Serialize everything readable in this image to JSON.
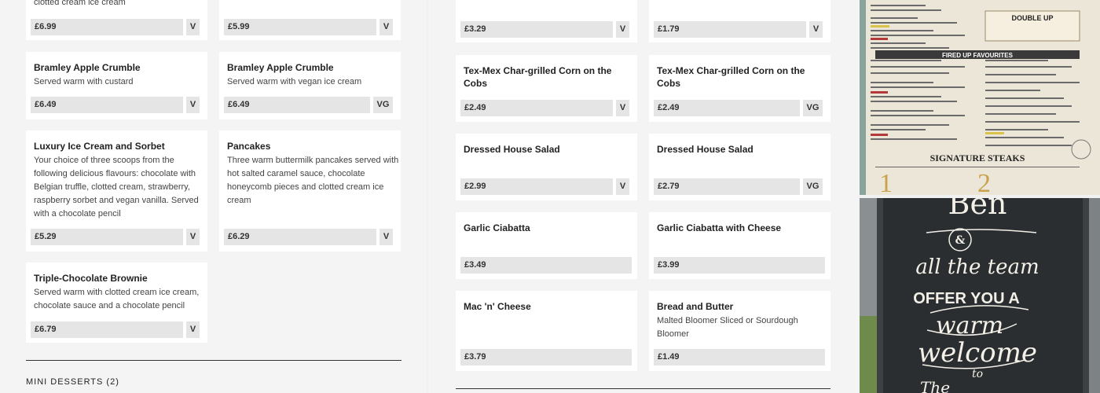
{
  "left_column": {
    "cards": [
      {
        "desc": "clotted cream ice cream",
        "price": "£6.99",
        "badge": "V"
      },
      {
        "desc": "",
        "price": "£5.99",
        "badge": "V"
      },
      {
        "title": "Bramley Apple Crumble",
        "desc": "Served warm with custard",
        "price": "£6.49",
        "badge": "V"
      },
      {
        "title": "Bramley Apple Crumble",
        "desc": "Served warm with vegan ice cream",
        "price": "£6.49",
        "badge": "VG"
      },
      {
        "title": "Luxury Ice Cream and Sorbet",
        "desc_lines": [
          "Your choice of three scoops from the",
          "following delicious flavours: chocolate with",
          "Belgian truffle, clotted cream, strawberry,",
          "raspberry sorbet and vegan vanilla. Served",
          "with a chocolate pencil"
        ],
        "price": "£5.29",
        "badge": "V"
      },
      {
        "title": "Pancakes",
        "desc_lines": [
          "Three warm buttermilk pancakes served with",
          "hot salted caramel sauce, chocolate",
          "honeycomb pieces and clotted cream ice",
          "cream"
        ],
        "price": "£6.29",
        "badge": "V"
      },
      {
        "title": "Triple-Chocolate Brownie",
        "desc_lines": [
          "Served warm with clotted cream ice cream,",
          "chocolate sauce and a chocolate pencil"
        ],
        "price": "£6.79",
        "badge": "V"
      }
    ],
    "section_title": "MINI DESSERTS (2)"
  },
  "middle_column": {
    "cards": [
      {
        "price": "£3.29",
        "badge": "V"
      },
      {
        "price": "£1.79",
        "badge": "V"
      },
      {
        "title": "Tex-Mex Char-grilled Corn on the Cobs",
        "price": "£2.49",
        "badge": "V"
      },
      {
        "title": "Tex-Mex Char-grilled Corn on the Cobs",
        "price": "£2.49",
        "badge": "VG"
      },
      {
        "title": "Dressed House Salad",
        "price": "£2.99",
        "badge": "V"
      },
      {
        "title": "Dressed House Salad",
        "price": "£2.79",
        "badge": "VG"
      },
      {
        "title": "Garlic Ciabatta",
        "price": "£3.49"
      },
      {
        "title": "Garlic Ciabatta with Cheese",
        "price": "£3.99"
      },
      {
        "title": "Mac 'n' Cheese",
        "price": "£3.79"
      },
      {
        "title": "Bread and Butter",
        "desc_lines": [
          "Malted Bloomer Sliced or Sourdough",
          "Bloomer"
        ],
        "price": "£1.49"
      }
    ]
  },
  "photos": {
    "menu": {
      "section_fired_up": "FIRED UP FAVOURITES",
      "section_double_up": "DOUBLE UP",
      "section_steaks": "SIGNATURE STEAKS"
    },
    "chalkboard": {
      "lines": [
        "Ben",
        "&",
        "all the team",
        "OFFER YOU A",
        "warm",
        "welcome",
        "to",
        "The"
      ]
    }
  },
  "colors": {
    "card_bg": "#ffffff",
    "price_bg": "#e5e5e5",
    "page_bg": "#f1f1f1"
  }
}
